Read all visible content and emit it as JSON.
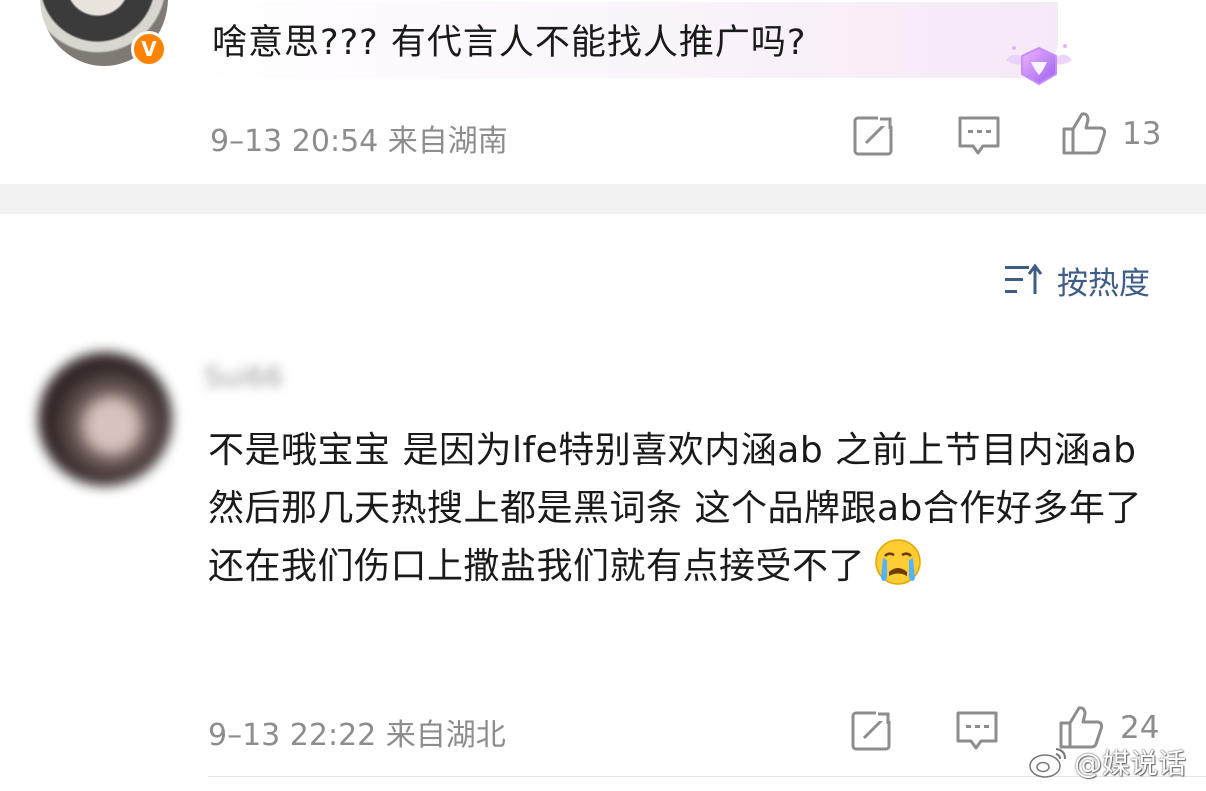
{
  "comment_top": {
    "text": "啥意思???  有代言人不能找人推广吗?",
    "verified_badge": "V",
    "meta": "9–13 20:54  来自湖南",
    "likes": "13",
    "icons": [
      "share-icon",
      "comment-icon",
      "like-icon",
      "diamond-badge-icon"
    ]
  },
  "sort": {
    "label": "按热度",
    "icon": "sort-icon"
  },
  "comment_2": {
    "username": "Sui66",
    "text": "不是哦宝宝  是因为lfe特别喜欢内涵ab 之前上节目内涵ab然后那几天热搜上都是黑词条  这个品牌跟ab合作好多年了还在我们伤口上撒盐我们就有点接受不了",
    "meta": "9–13 22:22  来自湖北",
    "likes": "24",
    "icons": [
      "crying-emoji-icon",
      "share-icon",
      "comment-icon",
      "like-icon"
    ]
  },
  "watermark": {
    "text": "@媒说话",
    "icon": "weibo-logo-icon"
  },
  "colors": {
    "meta_gray": "#8d8d8d",
    "sort_blue": "#3d5c86",
    "badge_orange": "#ff8200",
    "divider": "#f2f2f2"
  }
}
